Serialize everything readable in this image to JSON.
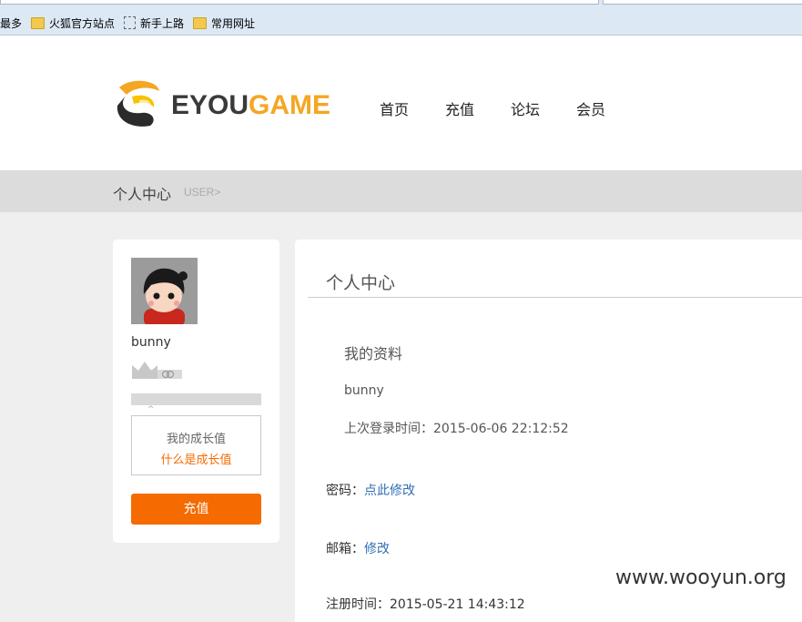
{
  "bookmarks": {
    "items": [
      {
        "label": "最多",
        "icon": "none"
      },
      {
        "label": "火狐官方站点",
        "icon": "folder-icon"
      },
      {
        "label": "新手上路",
        "icon": "page-icon"
      },
      {
        "label": "常用网址",
        "icon": "folder-icon"
      }
    ]
  },
  "header": {
    "logo_part1": "EYOU",
    "logo_part2": "GAME",
    "nav": [
      {
        "label": "首页"
      },
      {
        "label": "充值"
      },
      {
        "label": "论坛"
      },
      {
        "label": "会员"
      }
    ]
  },
  "breadcrumb": {
    "title": "个人中心",
    "sub": "USER>"
  },
  "sidebar": {
    "username": "bunny",
    "growth_progress": 0,
    "growth_title": "我的成长值",
    "growth_link": "什么是成长值",
    "recharge_label": "充值"
  },
  "main": {
    "title": "个人中心",
    "section_title": "我的资料",
    "profile_name": "bunny",
    "last_login": "上次登录时间：2015-06-06 22:12:52",
    "password_label": "密码：",
    "password_link": "点此修改",
    "email_label": "邮箱：",
    "email_link": "修改",
    "register_time": "注册时间：2015-05-21 14:43:12"
  },
  "watermark": "www.wooyun.org",
  "colors": {
    "accent": "#f56b00",
    "link": "#2f6fb5",
    "logo_game": "#f5a623"
  }
}
